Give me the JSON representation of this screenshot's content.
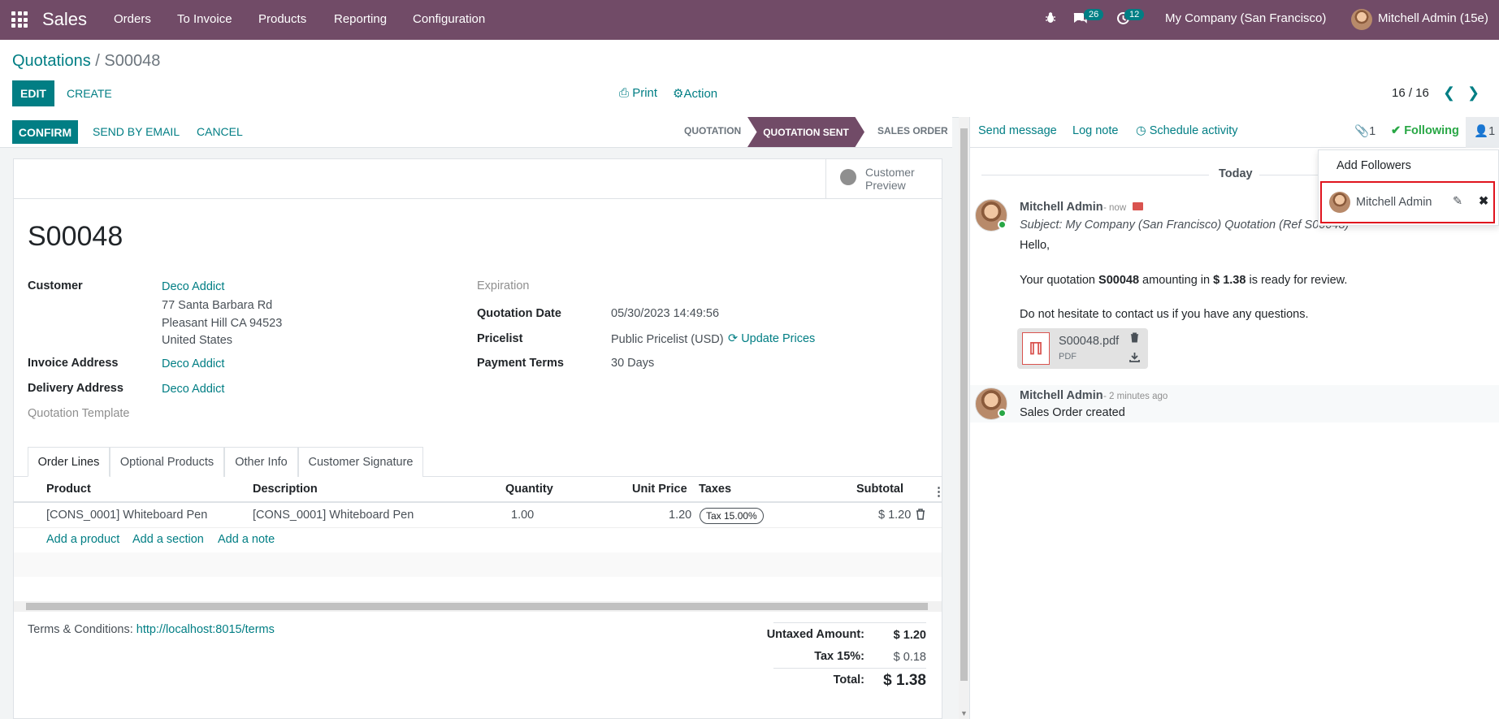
{
  "navbar": {
    "app_name": "Sales",
    "menu": [
      "Orders",
      "To Invoice",
      "Products",
      "Reporting",
      "Configuration"
    ],
    "messages_count": "26",
    "activities_count": "12",
    "company": "My Company (San Francisco)",
    "user": "Mitchell Admin (15e)"
  },
  "breadcrumb": {
    "parent": "Quotations",
    "separator": "/",
    "current": "S00048"
  },
  "control": {
    "edit": "EDIT",
    "create": "CREATE",
    "print": "Print",
    "action": "Action",
    "pager": "16 / 16"
  },
  "statusbar": {
    "confirm": "CONFIRM",
    "send_email": "SEND BY EMAIL",
    "cancel": "CANCEL",
    "stages": [
      "QUOTATION",
      "QUOTATION SENT",
      "SALES ORDER"
    ],
    "active_stage": "QUOTATION SENT"
  },
  "form": {
    "preview_line1": "Customer",
    "preview_line2": "Preview",
    "title": "S00048",
    "customer_label": "Customer",
    "customer_name": "Deco Addict",
    "address": [
      "77 Santa Barbara Rd",
      "Pleasant Hill CA 94523",
      "United States"
    ],
    "invoice_label": "Invoice Address",
    "invoice_value": "Deco Addict",
    "delivery_label": "Delivery Address",
    "delivery_value": "Deco Addict",
    "template_label": "Quotation Template",
    "expiration_label": "Expiration",
    "quotation_date_label": "Quotation Date",
    "quotation_date": "05/30/2023 14:49:56",
    "pricelist_label": "Pricelist",
    "pricelist": "Public Pricelist (USD)",
    "update_prices": "Update Prices",
    "payment_terms_label": "Payment Terms",
    "payment_terms": "30 Days"
  },
  "tabs": [
    "Order Lines",
    "Optional Products",
    "Other Info",
    "Customer Signature"
  ],
  "table": {
    "headers": [
      "Product",
      "Description",
      "Quantity",
      "Unit Price",
      "Taxes",
      "Subtotal"
    ],
    "row": {
      "product": "[CONS_0001] Whiteboard Pen",
      "description": "[CONS_0001] Whiteboard Pen",
      "quantity": "1.00",
      "unit_price": "1.20",
      "tax": "Tax 15.00%",
      "subtotal": "$ 1.20"
    },
    "add_product": "Add a product",
    "add_section": "Add a section",
    "add_note": "Add a note"
  },
  "footer": {
    "terms_label": "Terms & Conditions:",
    "terms_link": "http://localhost:8015/terms",
    "untaxed_label": "Untaxed Amount:",
    "untaxed": "$ 1.20",
    "tax_label": "Tax 15%:",
    "tax": "$ 0.18",
    "total_label": "Total:",
    "total": "$ 1.38"
  },
  "chatter": {
    "send_message": "Send message",
    "log_note": "Log note",
    "schedule": "Schedule activity",
    "attachments": "1",
    "following": "Following",
    "followers": "1",
    "today": "Today",
    "msg1": {
      "author": "Mitchell Admin",
      "date": "- now",
      "subject": "Subject: My Company (San Francisco) Quotation (Ref S00048)",
      "hello": "Hello,",
      "body_pre": "Your quotation ",
      "body_ref": "S00048",
      "body_mid": " amounting in ",
      "body_amount": "$ 1.38",
      "body_post": " is ready for review.",
      "contact": "Do not hesitate to contact us if you have any questions.",
      "attachment_name": "S00048.pdf",
      "attachment_type": "PDF"
    },
    "msg2": {
      "author": "Mitchell Admin",
      "date": "- 2 minutes ago",
      "text": "Sales Order created"
    }
  },
  "followers_dropdown": {
    "add": "Add Followers",
    "follower": "Mitchell Admin"
  },
  "colors": {
    "brand": "#714b67",
    "accent": "#017e84",
    "highlight": "#e0141e"
  }
}
